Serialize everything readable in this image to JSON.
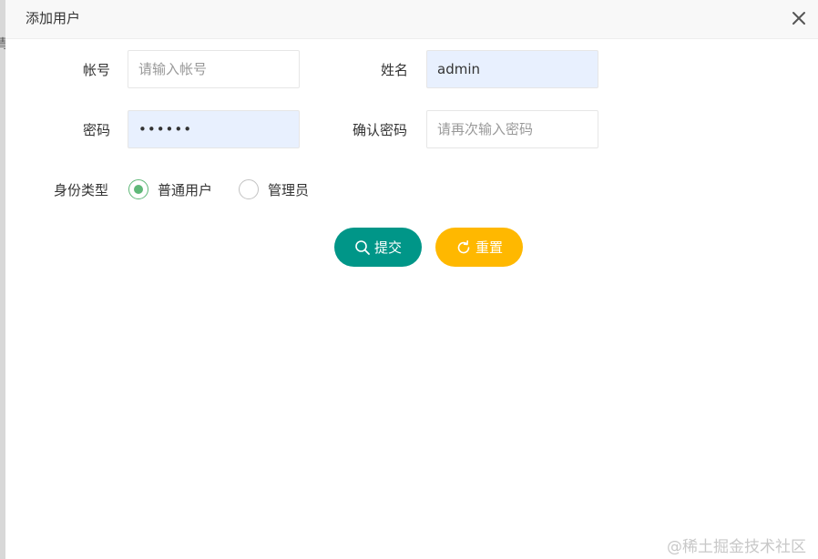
{
  "dialog": {
    "title": "添加用户",
    "close_icon": "close-icon"
  },
  "form": {
    "account": {
      "label": "帐号",
      "value": "",
      "placeholder": "请输入帐号"
    },
    "name": {
      "label": "姓名",
      "value": "admin",
      "placeholder": ""
    },
    "password": {
      "label": "密码",
      "value": "••••••",
      "placeholder": ""
    },
    "confirm_password": {
      "label": "确认密码",
      "value": "",
      "placeholder": "请再次输入密码"
    },
    "identity": {
      "label": "身份类型",
      "options": [
        {
          "label": "普通用户",
          "checked": true
        },
        {
          "label": "管理员",
          "checked": false
        }
      ]
    }
  },
  "buttons": {
    "submit": {
      "label": "提交",
      "icon": "search-icon"
    },
    "reset": {
      "label": "重置",
      "icon": "refresh-icon"
    }
  },
  "watermark": "@稀土掘金技术社区",
  "colors": {
    "submit": "#009688",
    "reset": "#ffb800",
    "radio_checked": "#5fb878",
    "autofill_bg": "#e8f0fe"
  }
}
